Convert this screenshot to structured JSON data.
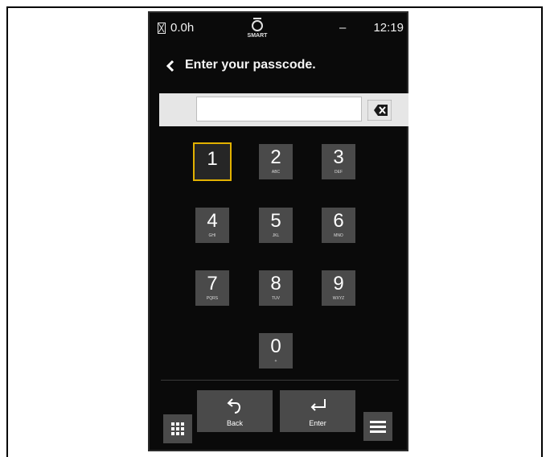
{
  "status_bar": {
    "hours": "0.0h",
    "logo_text": "SMART",
    "dash": "–",
    "time": "12:19"
  },
  "header": {
    "title": "Enter your passcode."
  },
  "passcode": {
    "value": ""
  },
  "keypad": {
    "keys": [
      {
        "num": "1",
        "letters": ""
      },
      {
        "num": "2",
        "letters": "ABC"
      },
      {
        "num": "3",
        "letters": "DEF"
      },
      {
        "num": "4",
        "letters": "GHI"
      },
      {
        "num": "5",
        "letters": "JKL"
      },
      {
        "num": "6",
        "letters": "MNO"
      },
      {
        "num": "7",
        "letters": "PQRS"
      },
      {
        "num": "8",
        "letters": "TUV"
      },
      {
        "num": "9",
        "letters": "WXYZ"
      },
      {
        "num": "0",
        "letters": "+"
      }
    ],
    "selected_key": "1"
  },
  "footer": {
    "back_label": "Back",
    "enter_label": "Enter"
  },
  "colors": {
    "selection": "#e2b100",
    "key_bg": "#4a4a4a",
    "screen_bg": "#0a0a0a"
  },
  "icons": [
    "hourglass-icon",
    "smart-logo-icon",
    "chevron-left-icon",
    "backspace-icon",
    "grid-icon",
    "undo-icon",
    "enter-arrow-icon",
    "hamburger-menu-icon"
  ]
}
